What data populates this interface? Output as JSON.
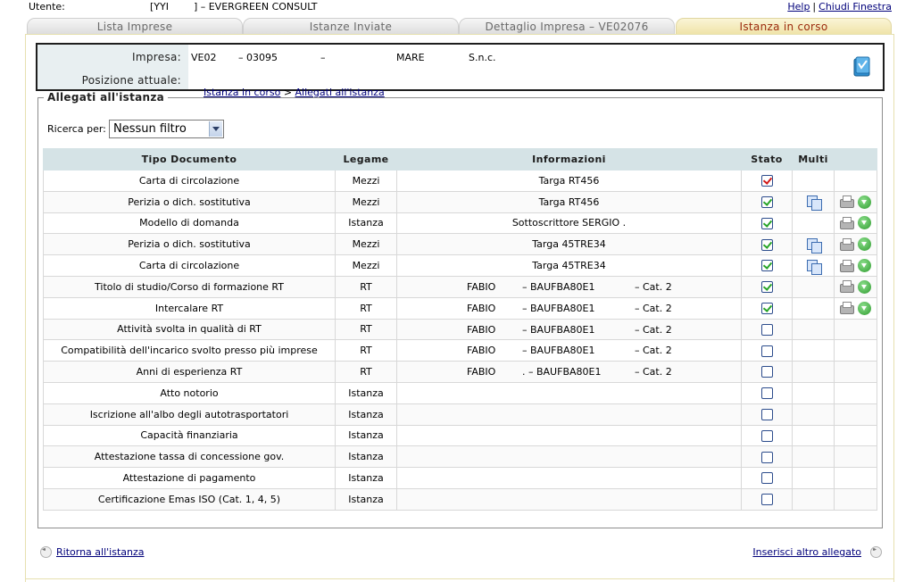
{
  "user": {
    "label": "Utente:",
    "value": "[YYI        ] – EVERGREEN CONSULT"
  },
  "top_links": {
    "help": "Help",
    "separator": "|",
    "close": "Chiudi Finestra"
  },
  "tabs": [
    {
      "label": "Lista Imprese"
    },
    {
      "label": "Istanze Inviate"
    },
    {
      "label": "Dettaglio Impresa – VE02076"
    },
    {
      "label": "Istanza in corso"
    }
  ],
  "company": {
    "label": "Impresa:",
    "code": "VE02",
    "number": "– 03095",
    "dash": "–",
    "name": "MARE",
    "form": "S.n.c.",
    "position_label": "Posizione attuale:",
    "crumb1": "Istanza in corso",
    "crumb_sep": ">",
    "crumb2": "Allegati all'istanza"
  },
  "section": {
    "title": "Allegati all'istanza"
  },
  "filter": {
    "label": "Ricerca per:",
    "selected": "Nessun filtro"
  },
  "table": {
    "headers": [
      "Tipo Documento",
      "Legame",
      "Informazioni",
      "Stato",
      "Multi",
      ""
    ],
    "rows": [
      {
        "tipo": "Carta di circolazione",
        "legame": "Mezzi",
        "info": "Targa RT456",
        "stato": "error",
        "multi": false,
        "actions": false
      },
      {
        "tipo": "Perizia o dich. sostitutiva",
        "legame": "Mezzi",
        "info": "Targa RT456",
        "stato": "ok",
        "multi": true,
        "actions": true
      },
      {
        "tipo": "Modello di domanda",
        "legame": "Istanza",
        "info": "Sottoscrittore SERGIO      .",
        "stato": "ok",
        "multi": false,
        "actions": true
      },
      {
        "tipo": "Perizia o dich. sostitutiva",
        "legame": "Mezzi",
        "info": "Targa 45TRE34",
        "stato": "ok",
        "multi": true,
        "actions": true
      },
      {
        "tipo": "Carta di circolazione",
        "legame": "Mezzi",
        "info": "Targa 45TRE34",
        "stato": "ok",
        "multi": true,
        "actions": true
      },
      {
        "tipo": "Titolo di studio/Corso di formazione RT",
        "legame": "RT",
        "rt_name": "FABIO",
        "rt_code": "– BAUFBA80E1",
        "rt_cat": "– Cat. 2",
        "stato": "ok",
        "multi": false,
        "actions": true
      },
      {
        "tipo": "Intercalare RT",
        "legame": "RT",
        "rt_name": "FABIO",
        "rt_code": "– BAUFBA80E1",
        "rt_cat": "– Cat. 2",
        "stato": "ok",
        "multi": false,
        "actions": true
      },
      {
        "tipo": "Attività svolta in qualità di RT",
        "legame": "RT",
        "rt_name": "FABIO",
        "rt_code": "– BAUFBA80E1",
        "rt_cat": "– Cat. 2",
        "stato": "empty",
        "multi": false,
        "actions": false
      },
      {
        "tipo": "Compatibilità dell'incarico svolto presso più imprese",
        "legame": "RT",
        "rt_name": "FABIO",
        "rt_code": "– BAUFBA80E1",
        "rt_cat": "– Cat. 2",
        "stato": "empty",
        "multi": false,
        "actions": false
      },
      {
        "tipo": "Anni di esperienza RT",
        "legame": "RT",
        "rt_name": "FABIO",
        "rt_code": ". – BAUFBA80E1",
        "rt_cat": "– Cat. 2",
        "stato": "empty",
        "multi": false,
        "actions": false
      },
      {
        "tipo": "Atto notorio",
        "legame": "Istanza",
        "info": "",
        "stato": "empty",
        "multi": false,
        "actions": false
      },
      {
        "tipo": "Iscrizione all'albo degli autotrasportatori",
        "legame": "Istanza",
        "info": "",
        "stato": "empty",
        "multi": false,
        "actions": false
      },
      {
        "tipo": "Capacità finanziaria",
        "legame": "Istanza",
        "info": "",
        "stato": "empty",
        "multi": false,
        "actions": false
      },
      {
        "tipo": "Attestazione tassa di concessione gov.",
        "legame": "Istanza",
        "info": "",
        "stato": "empty",
        "multi": false,
        "actions": false
      },
      {
        "tipo": "Attestazione di pagamento",
        "legame": "Istanza",
        "info": "",
        "stato": "empty",
        "multi": false,
        "actions": false
      },
      {
        "tipo": "Certificazione Emas ISO (Cat. 1, 4, 5)",
        "legame": "Istanza",
        "info": "",
        "stato": "empty",
        "multi": false,
        "actions": false
      }
    ]
  },
  "nav": {
    "back": "Ritorna all'istanza",
    "add": "Inserisci altro allegato"
  },
  "colors": {
    "accent_tab": "#9b2a0e",
    "header_bg": "#d5e3e6",
    "link": "#00007a",
    "ok": "#28a428",
    "error": "#d01818"
  }
}
